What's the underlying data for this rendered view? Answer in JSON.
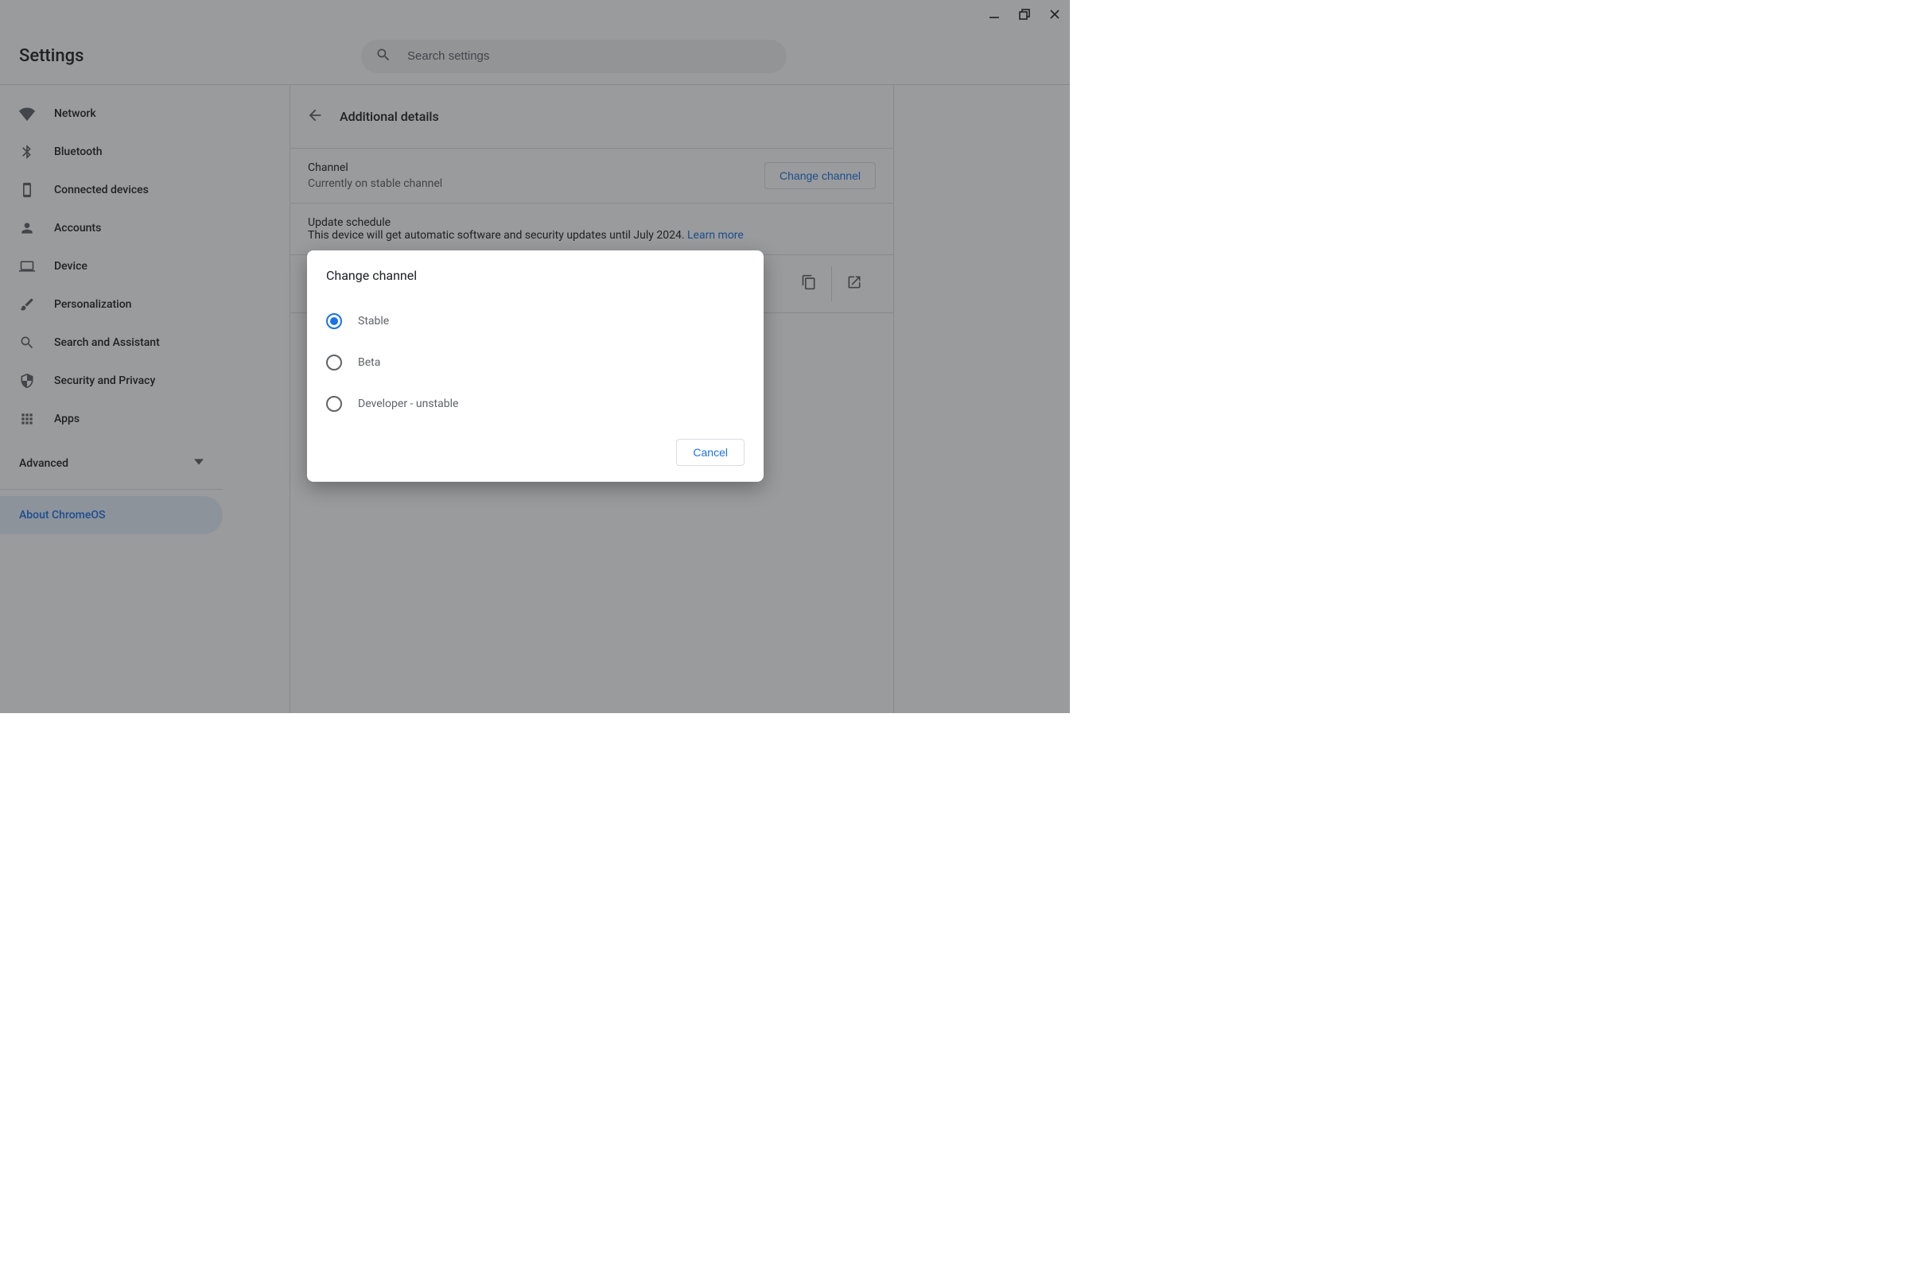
{
  "app_title": "Settings",
  "search": {
    "placeholder": "Search settings"
  },
  "sidebar": {
    "items": [
      {
        "label": "Network",
        "icon": "wifi"
      },
      {
        "label": "Bluetooth",
        "icon": "bluetooth"
      },
      {
        "label": "Connected devices",
        "icon": "phone"
      },
      {
        "label": "Accounts",
        "icon": "person"
      },
      {
        "label": "Device",
        "icon": "laptop"
      },
      {
        "label": "Personalization",
        "icon": "brush"
      },
      {
        "label": "Search and Assistant",
        "icon": "search"
      },
      {
        "label": "Security and Privacy",
        "icon": "shield"
      },
      {
        "label": "Apps",
        "icon": "apps"
      }
    ],
    "advanced_label": "Advanced",
    "about_label": "About ChromeOS"
  },
  "page": {
    "title": "Additional details",
    "channel": {
      "title": "Channel",
      "subtitle": "Currently on stable channel",
      "button": "Change channel"
    },
    "update": {
      "title": "Update schedule",
      "subtitle_prefix": "This device will get automatic software and security updates until July 2024. ",
      "learn_more": "Learn more"
    }
  },
  "dialog": {
    "title": "Change channel",
    "options": [
      {
        "label": "Stable",
        "checked": true
      },
      {
        "label": "Beta",
        "checked": false
      },
      {
        "label": "Developer - unstable",
        "checked": false
      }
    ],
    "cancel": "Cancel"
  }
}
